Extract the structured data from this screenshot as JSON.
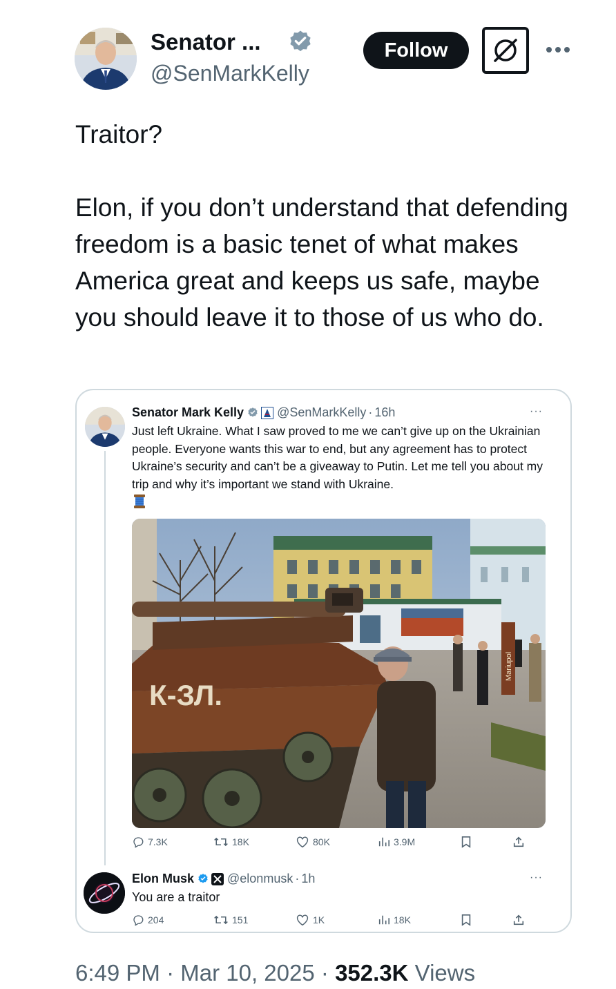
{
  "author": {
    "name": "Senator ...",
    "handle": "@SenMarkKelly",
    "follow_label": "Follow",
    "verified_color": "#829aab"
  },
  "tweet": {
    "text": "Traitor?\n\nElon, if you don’t understand that defending freedom is a basic tenet of what makes America great and keeps us safe, maybe you should leave it to those of us who do."
  },
  "quote": {
    "name": "Senator Mark Kelly",
    "handle": "@SenMarkKelly",
    "time": "16h",
    "text": "Just left Ukraine. What I saw proved to me we can’t give up on the Ukrainian people. Everyone wants this war to end, but any agreement has to protect Ukraine’s security and can’t be a giveaway to Putin. Let me tell you about my trip and why it’s important we stand with Ukraine.",
    "emoji_icon": "thread-spool-icon",
    "photo_sign": "Mariupol",
    "photo_tank_text": "К-ЗЛ.",
    "stats": {
      "replies": "7.3K",
      "reposts": "18K",
      "likes": "80K",
      "views": "3.9M"
    },
    "reply": {
      "name": "Elon Musk",
      "handle": "@elonmusk",
      "time": "1h",
      "text": "You are a traitor",
      "stats": {
        "replies": "204",
        "reposts": "151",
        "likes": "1K",
        "views": "18K"
      }
    }
  },
  "footer": {
    "time": "6:49 PM",
    "date": "Mar 10, 2025",
    "views_count": "352.3K",
    "views_label": "Views",
    "separator": "·"
  }
}
